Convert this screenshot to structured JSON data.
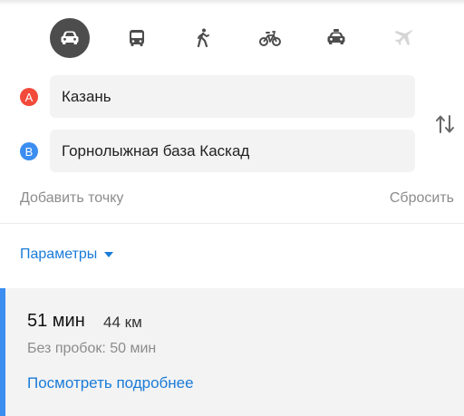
{
  "transport_modes": [
    {
      "id": "car",
      "icon": "car-icon",
      "active": true
    },
    {
      "id": "bus",
      "icon": "bus-icon",
      "active": false
    },
    {
      "id": "walk",
      "icon": "pedestrian-icon",
      "active": false
    },
    {
      "id": "bike",
      "icon": "bicycle-icon",
      "active": false
    },
    {
      "id": "taxi",
      "icon": "taxi-icon",
      "active": false
    },
    {
      "id": "plane",
      "icon": "airplane-icon",
      "active": false,
      "disabled": true
    }
  ],
  "route_form": {
    "point_a": {
      "marker": "A",
      "value": "Казань"
    },
    "point_b": {
      "marker": "B",
      "value": "Горнолыжная база Каскад"
    },
    "add_point_label": "Добавить точку",
    "reset_label": "Сбросить"
  },
  "parameters_label": "Параметры",
  "route_summary": {
    "time": "51 мин",
    "distance": "44 км",
    "no_traffic": "Без пробок: 50 мин",
    "details_link": "Посмотреть подробнее"
  },
  "colors": {
    "accent": "#1a7bd8",
    "marker_a": "#f24a3b",
    "marker_b": "#3b8ef0",
    "active_mode_bg": "#4d4d4d"
  }
}
